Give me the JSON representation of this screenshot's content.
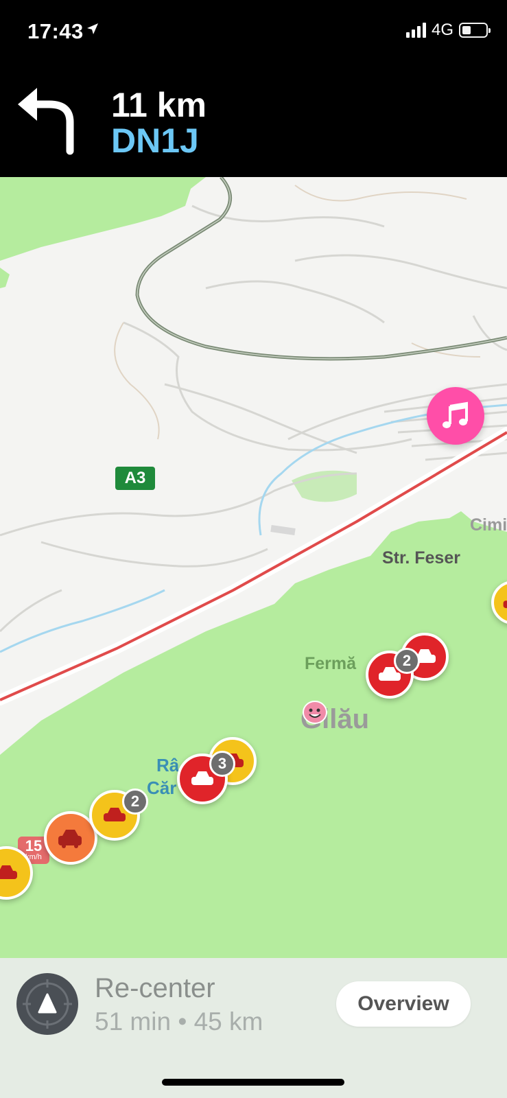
{
  "status_bar": {
    "time": "17:43",
    "network": "4G"
  },
  "navigation": {
    "distance": "11 km",
    "road": "DN1J",
    "turn": "left"
  },
  "map": {
    "labels": {
      "highway_shield": "A3",
      "street": "Str. Feser",
      "cimi": "Cimi",
      "ferma": "Fermă",
      "town": "Gilău",
      "ra": "Râ",
      "car": "Căr"
    },
    "speed_limit": {
      "value": "15",
      "unit": "km/h"
    },
    "jam_counts": [
      "2",
      "2",
      "3"
    ]
  },
  "bottom_panel": {
    "recenter_label": "Re-center",
    "eta": "51 min • 45 km",
    "overview_label": "Overview"
  },
  "colors": {
    "nav_road": "#6cc7f5",
    "music_button": "#ff4ea8",
    "traffic_red": "#e0242a",
    "traffic_yellow": "#f4c31b",
    "traffic_orange": "#f47a3c",
    "park_green": "#b5ec9e"
  }
}
